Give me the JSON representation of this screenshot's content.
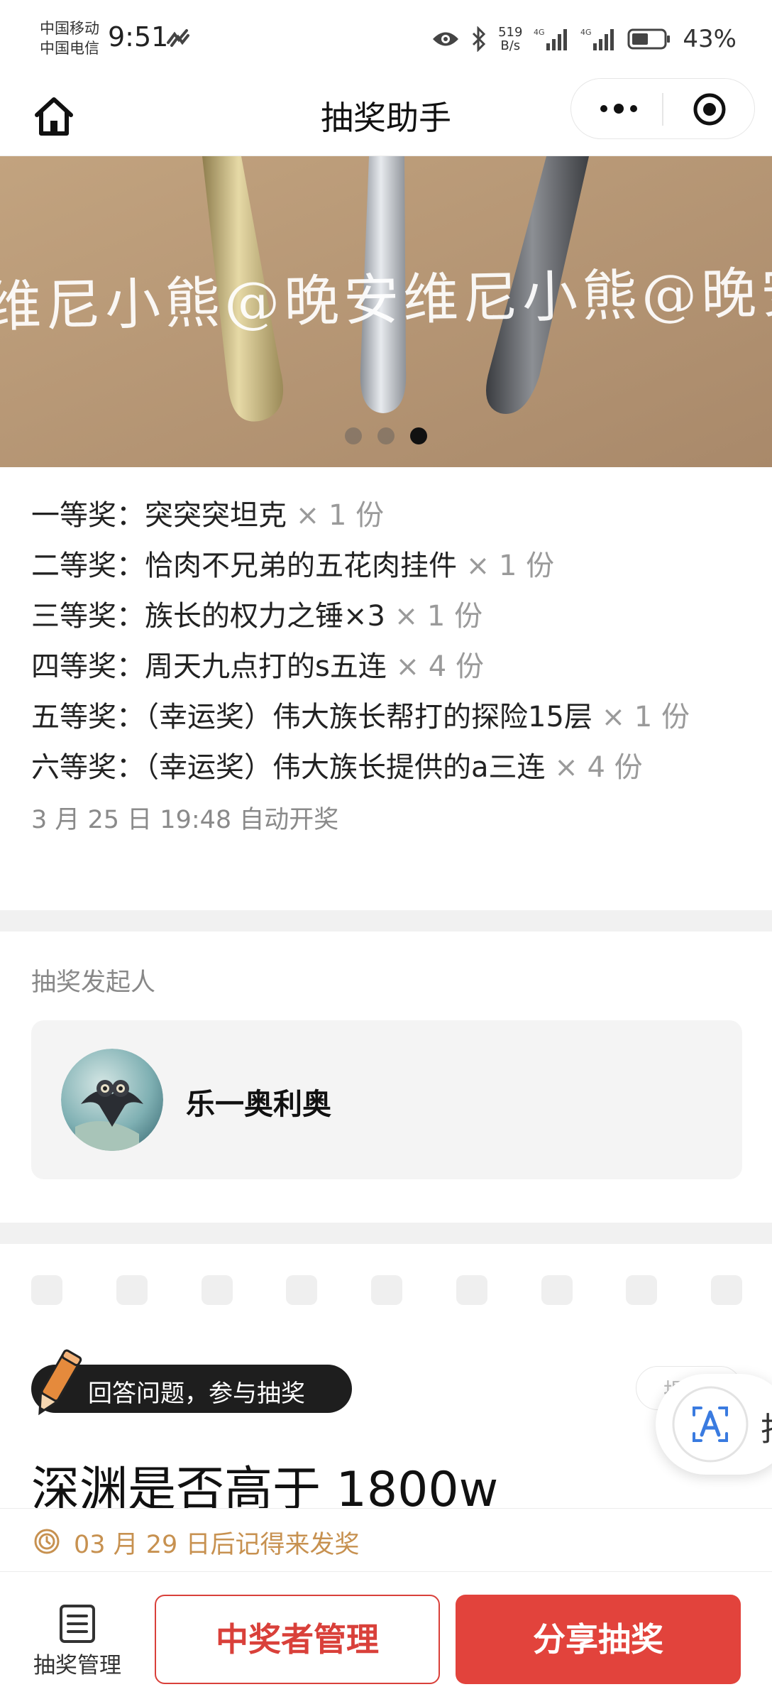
{
  "status_bar": {
    "carrier_1": "中国移动",
    "carrier_2": "中国电信",
    "time": "9:51",
    "net_speed_value": "519",
    "net_speed_unit": "B/s",
    "battery": "43%",
    "icons": [
      "wave-icon",
      "eye-icon",
      "bluetooth-icon",
      "signal-4g-icon",
      "signal-4g-icon",
      "battery-icon"
    ]
  },
  "header": {
    "title": "抽奖助手",
    "icons": [
      "home-icon",
      "more-icon",
      "close-icon"
    ]
  },
  "banner": {
    "watermark": "维尼小熊@晚安维尼小熊@晚安维",
    "slide_count": 3,
    "active_slide": 3
  },
  "prizes": [
    {
      "tier": "一等奖：",
      "name": "突突突坦克",
      "qty": "× 1 份"
    },
    {
      "tier": "二等奖：",
      "name": "恰肉不兄弟的五花肉挂件",
      "qty": "× 1 份"
    },
    {
      "tier": "三等奖：",
      "name": "族长的权力之锤×3",
      "qty": "× 1 份"
    },
    {
      "tier": "四等奖：",
      "name": "周天九点打的s五连",
      "qty": "× 4 份"
    },
    {
      "tier": "五等奖：",
      "name": "（幸运奖）伟大族长帮打的探险15层",
      "qty": "× 1 份"
    },
    {
      "tier": "六等奖：",
      "name": "（幸运奖）伟大族长提供的a三连",
      "qty": "× 4 份"
    }
  ],
  "draw_time": "3 月 25 日 19:48 自动开奖",
  "initiator": {
    "label": "抽奖发起人",
    "name": "乐一奥利奥"
  },
  "question": {
    "tag": "回答问题，参与抽奖",
    "hint": "提",
    "text": "深渊是否高于 1800w",
    "floating_peek": "批"
  },
  "reminder": "03 月 29 日后记得来发奖",
  "bottom": {
    "manage_label": "抽奖管理",
    "winners_button": "中奖者管理",
    "share_button": "分享抽奖"
  },
  "colors": {
    "accent_red": "#e2433c",
    "reminder_gold": "#c79150"
  }
}
